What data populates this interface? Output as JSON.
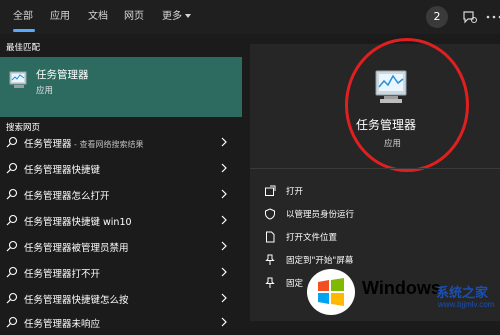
{
  "tabs": [
    {
      "label": "全部",
      "active": true
    },
    {
      "label": "应用"
    },
    {
      "label": "文档"
    },
    {
      "label": "网页"
    },
    {
      "label": "更多"
    }
  ],
  "header": {
    "badge_count": "2"
  },
  "left": {
    "best_match_heading": "最佳匹配",
    "best_match": {
      "title": "任务管理器",
      "subtitle": "应用",
      "icon": "task-manager-icon"
    },
    "web_heading": "搜索网页",
    "web_results": [
      {
        "text": "任务管理器",
        "sub": " - 查看网络搜索结果"
      },
      {
        "text": "任务管理器快捷键"
      },
      {
        "text": "任务管理器怎么打开"
      },
      {
        "text": "任务管理器快捷键 win10"
      },
      {
        "text": "任务管理器被管理员禁用"
      },
      {
        "text": "任务管理器打不开"
      },
      {
        "text": "任务管理器快捷键怎么按"
      },
      {
        "text": "任务管理器未响应"
      }
    ]
  },
  "right": {
    "app_title": "任务管理器",
    "app_subtitle": "应用",
    "actions": [
      {
        "label": "打开",
        "icon": "open-icon"
      },
      {
        "label": "以管理员身份运行",
        "icon": "shield-icon"
      },
      {
        "label": "打开文件位置",
        "icon": "file-icon"
      },
      {
        "label": "固定到\"开始\"屏幕",
        "icon": "pin-icon"
      },
      {
        "label": "固定",
        "icon": "pin-icon"
      }
    ]
  },
  "watermark": {
    "brand": "Windows",
    "suffix": "系统之家",
    "url": "www.bjjmlv.com"
  },
  "colors": {
    "accent": "#5aa9ff",
    "selected_bg": "#2d6b61",
    "annotation": "#e02020"
  }
}
